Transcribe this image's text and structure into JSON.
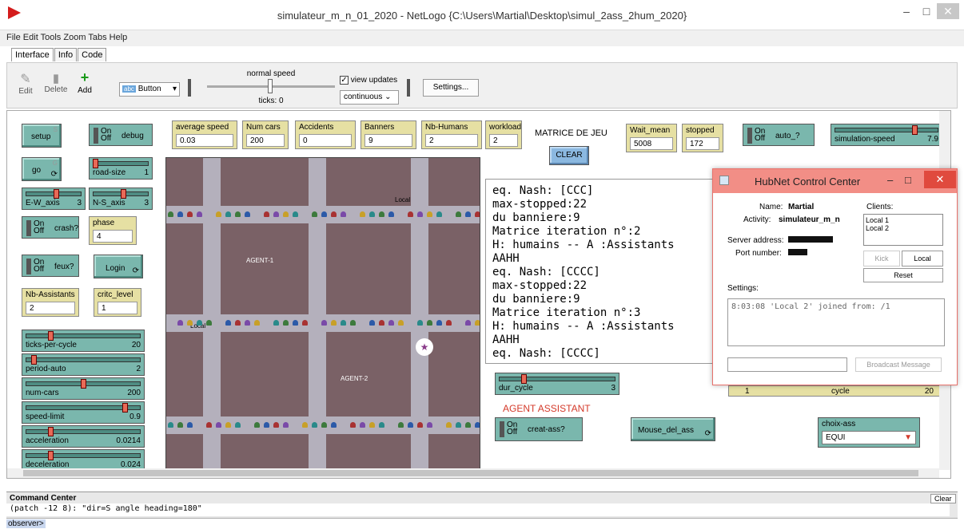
{
  "window": {
    "title": "simulateur_m_n_01_2020 - NetLogo {C:\\Users\\Martial\\Desktop\\simul_2ass_2hum_2020}"
  },
  "menu": [
    "File",
    "Edit",
    "Tools",
    "Zoom",
    "Tabs",
    "Help"
  ],
  "tabs": [
    "Interface",
    "Info",
    "Code"
  ],
  "toolbar": {
    "edit": "Edit",
    "delete": "Delete",
    "add": "Add",
    "widget_select": "Button",
    "speed_label": "normal speed",
    "ticks": "ticks: 0",
    "view_updates": "view updates",
    "update_mode": "continuous",
    "settings": "Settings..."
  },
  "buttons": {
    "setup": "setup",
    "setup_key": "S",
    "go": "go",
    "go_key": "G",
    "login": "Login",
    "clear": "CLEAR",
    "mouse_del_ass": "Mouse_del_ass"
  },
  "switches": {
    "on_off": "On\nOff",
    "debug": "debug",
    "crash": "crash?",
    "feux": "feux?",
    "auto": "auto_?",
    "creat_ass": "creat-ass?"
  },
  "sliders": [
    {
      "id": "road-size",
      "label": "road-size",
      "value": "1",
      "fraction": 0.0
    },
    {
      "id": "ew-axis",
      "label": "E-W_axis",
      "value": "3",
      "fraction": 0.55
    },
    {
      "id": "ns-axis",
      "label": "N-S_axis",
      "value": "3",
      "fraction": 0.55
    },
    {
      "id": "ticks-per-cycle",
      "label": "ticks-per-cycle",
      "value": "20",
      "fraction": 0.2
    },
    {
      "id": "period-auto",
      "label": "period-auto",
      "value": "2",
      "fraction": 0.05
    },
    {
      "id": "num-cars",
      "label": "num-cars",
      "value": "200",
      "fraction": 0.5
    },
    {
      "id": "speed-limit",
      "label": "speed-limit",
      "value": "0.9",
      "fraction": 0.88
    },
    {
      "id": "acceleration",
      "label": "acceleration",
      "value": "0.0214",
      "fraction": 0.2
    },
    {
      "id": "deceleration",
      "label": "deceleration",
      "value": "0.024",
      "fraction": 0.2
    },
    {
      "id": "simulation-speed",
      "label": "simulation-speed",
      "value": "7.9",
      "fraction": 0.78
    },
    {
      "id": "dur-cycle",
      "label": "dur_cycle",
      "value": "3",
      "fraction": 0.2
    }
  ],
  "monitors": {
    "average_speed": {
      "label": "average speed",
      "value": "0.03"
    },
    "num_cars": {
      "label": "Num cars",
      "value": "200"
    },
    "accidents": {
      "label": "Accidents",
      "value": "0"
    },
    "banners": {
      "label": "Banners",
      "value": "9"
    },
    "nb_humans": {
      "label": "Nb-Humans",
      "value": "2"
    },
    "workload": {
      "label": "workload",
      "value": "2"
    },
    "wait_mean": {
      "label": "Wait_mean",
      "value": "5008"
    },
    "stopped": {
      "label": "stopped",
      "value": "172"
    },
    "phase": {
      "label": "phase",
      "value": "4"
    },
    "nb_assistants": {
      "label": "Nb-Assistants",
      "value": "2"
    },
    "critc_level": {
      "label": "critc_level",
      "value": "1"
    }
  },
  "labels": {
    "matrice": "MATRICE DE JEU",
    "agent_assistant": "AGENT ASSISTANT",
    "agent1": "AGENT-1",
    "agent2": "AGENT-2",
    "local": "Local"
  },
  "chooser": {
    "label": "choix-ass",
    "value": "EQUI"
  },
  "output_lines": [
    "eq. Nash: [CCC]",
    "max-stopped:22",
    "du banniere:9",
    "Matrice iteration n°:2",
    "H: humains -- A :Assistants",
    "AAHH",
    "eq. Nash: [CCCC]",
    "max-stopped:22",
    "du banniere:9",
    "Matrice iteration n°:3",
    "H: humains -- A :Assistants",
    "AAHH",
    "eq. Nash: [CCCC]"
  ],
  "cycle_row": {
    "left": "1",
    "label": "cycle",
    "right": "20"
  },
  "hubnet": {
    "title": "HubNet Control Center",
    "name_label": "Name:",
    "name_value": "Martial",
    "activity_label": "Activity:",
    "activity_value": "simulateur_m_n",
    "server_label": "Server address:",
    "port_label": "Port number:",
    "clients_label": "Clients:",
    "clients": [
      "Local 1",
      "Local 2"
    ],
    "kick": "Kick",
    "local": "Local",
    "reset": "Reset",
    "settings_label": "Settings:",
    "log": "8:03:08   'Local 2' joined from: /1",
    "broadcast": "Broadcast Message"
  },
  "command_center": {
    "title": "Command Center",
    "line": "(patch -12 8): \"dir=S angle heading=180\"",
    "prompt": "observer>",
    "clear": "Clear"
  }
}
